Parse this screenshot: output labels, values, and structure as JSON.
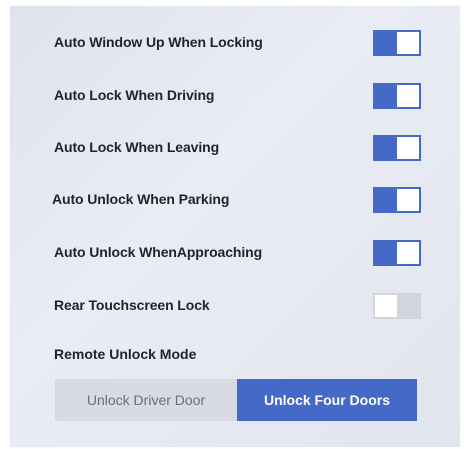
{
  "settings": [
    {
      "label": "Auto Window Up When Locking",
      "on": true
    },
    {
      "label": "Auto Lock When Driving",
      "on": true
    },
    {
      "label": "Auto Lock When Leaving",
      "on": true
    },
    {
      "label": "Auto Unlock When Parking",
      "on": true
    },
    {
      "label": "Auto Unlock WhenApproaching",
      "on": true
    },
    {
      "label": "Rear Touchscreen Lock",
      "on": false
    }
  ],
  "remote_unlock": {
    "title": "Remote Unlock Mode",
    "options": [
      "Unlock Driver Door",
      "Unlock Four Doors"
    ],
    "selected": "Unlock Four Doors"
  },
  "colors": {
    "accent": "#4469c6",
    "toggle_off": "#d3d5dc",
    "segment_inactive": "#d9dbe2",
    "panel_bg": "#e6e9f1"
  }
}
